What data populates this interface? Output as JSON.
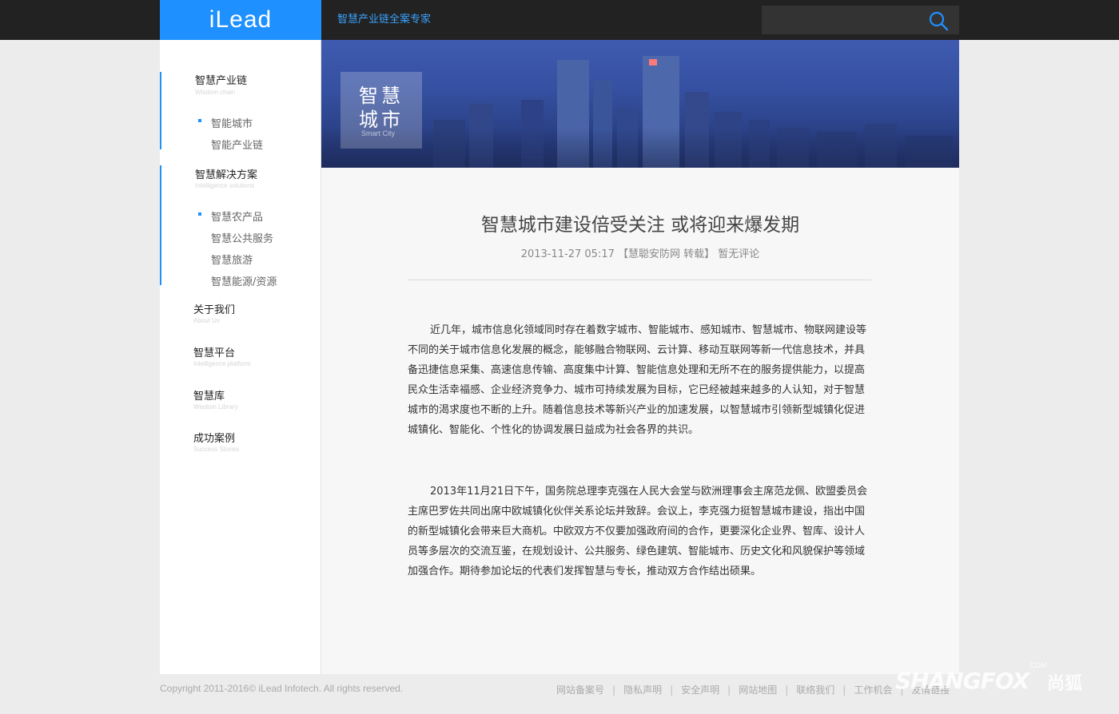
{
  "header": {
    "logo": "iLead",
    "tagline": "智慧产业链全案专家",
    "search_placeholder": ""
  },
  "sidebar": {
    "groups": [
      {
        "title": "智慧产业链",
        "subtitle": "Wisdom chain",
        "items": [
          "智能城市",
          "智能产业链"
        ]
      },
      {
        "title": "智慧解决方案",
        "subtitle": "Intelligence solutions",
        "items": [
          "智慧农产品",
          "智慧公共服务",
          "智慧旅游",
          "智慧能源/资源"
        ]
      },
      {
        "title": "关于我们",
        "subtitle": "About Us",
        "items": []
      },
      {
        "title": "智慧平台",
        "subtitle": "Intelligence platform",
        "items": []
      },
      {
        "title": "智慧库",
        "subtitle": "Wisdom Library",
        "items": []
      },
      {
        "title": "成功案例",
        "subtitle": "Success Stories",
        "items": []
      }
    ]
  },
  "banner": {
    "tag_line1": "智慧",
    "tag_line2": "城市",
    "tag_en": "Smart City"
  },
  "article": {
    "title": "智慧城市建设倍受关注 或将迎来爆发期",
    "meta": "2013-11-27 05:17 【慧聪安防网 转载】 暂无评论",
    "paragraphs": [
      "近几年，城市信息化领域同时存在着数字城市、智能城市、感知城市、智慧城市、物联网建设等不同的关于城市信息化发展的概念，能够融合物联网、云计算、移动互联网等新一代信息技术，并具备迅捷信息采集、高速信息传输、高度集中计算、智能信息处理和无所不在的服务提供能力，以提高民众生活幸福感、企业经济竞争力、城市可持续发展为目标，它已经被越来越多的人认知，对于智慧城市的渴求度也不断的上升。随着信息技术等新兴产业的加速发展，以智慧城市引领新型城镇化促进城镇化、智能化、个性化的协调发展日益成为社会各界的共识。",
      "2013年11月21日下午，国务院总理李克强在人民大会堂与欧洲理事会主席范龙佩、欧盟委员会主席巴罗佐共同出席中欧城镇化伙伴关系论坛并致辞。会议上，李克强力挺智慧城市建设，指出中国的新型城镇化会带来巨大商机。中欧双方不仅要加强政府间的合作，更要深化企业界、智库、设计人员等多层次的交流互鉴，在规划设计、公共服务、绿色建筑、智能城市、历史文化和风貌保护等领域加强合作。期待参加论坛的代表们发挥智慧与专长，推动双方合作结出硕果。"
    ]
  },
  "footer": {
    "copyright": "Copyright 2011-2016© iLead Infotech. All rights reserved.",
    "links": [
      "网站备案号",
      "隐私声明",
      "安全声明",
      "网站地图",
      "联络我们",
      "工作机会",
      "友情链接"
    ]
  },
  "watermark": {
    "text": "SHANGFOX",
    "com": ".COM",
    "cn": "尚狐"
  },
  "colors": {
    "accent": "#1e90ff",
    "topbar": "#222222"
  }
}
